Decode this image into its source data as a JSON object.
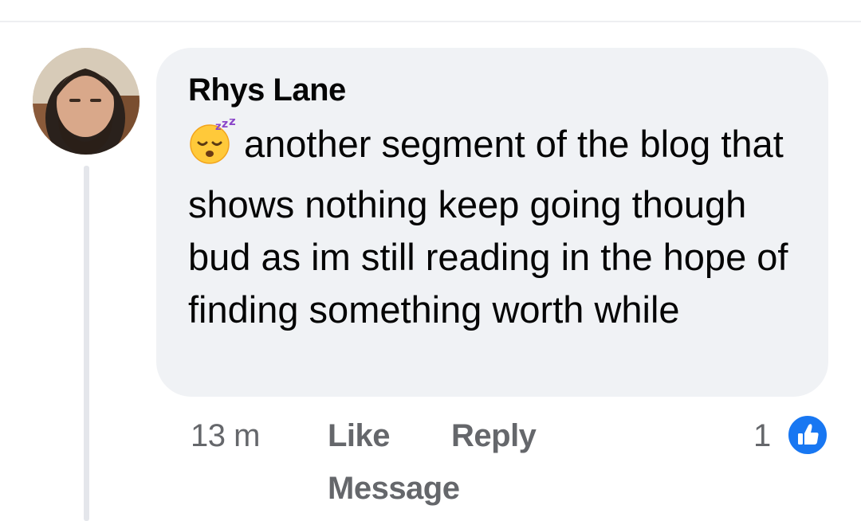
{
  "comment": {
    "author": "Rhys Lane",
    "emoji": "sleeping-face",
    "text": "another segment of the blog that shows nothing keep going though bud as im still reading in the hope of finding something worth while",
    "timestamp": "13 m",
    "actions": {
      "like": "Like",
      "reply": "Reply",
      "message": "Message"
    },
    "reaction_count": "1",
    "reaction_type": "like-icon"
  },
  "colors": {
    "bubble": "#f0f2f5",
    "text": "#050505",
    "muted": "#65676b",
    "like_blue": "#1877f2",
    "thread_line": "#e4e6eb"
  }
}
